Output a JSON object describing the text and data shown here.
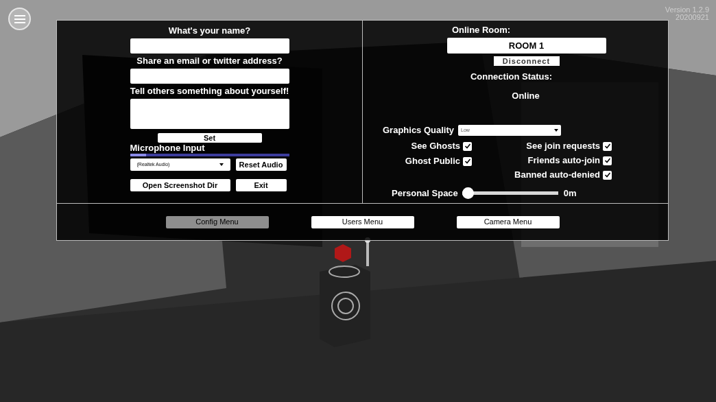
{
  "version": {
    "label": "Version 1.2.9",
    "build": "20200921"
  },
  "profile": {
    "fields": [
      {
        "label": "What's your name?",
        "kind": "line"
      },
      {
        "label": "Share an email or twitter address?",
        "kind": "line"
      },
      {
        "label": "Tell others something about yourself!",
        "kind": "area"
      }
    ],
    "set_button": "Set",
    "microphone": {
      "label": "Microphone Input",
      "level": 0.1,
      "device": "(Realtek Audio)",
      "reset_button": "Reset Audio"
    },
    "buttons": [
      "Open Screenshot Dir",
      "Exit"
    ]
  },
  "room": {
    "label": "Online Room:",
    "value": "ROOM 1",
    "disconnect_button": "Disconnect",
    "status_label": "Connection Status:",
    "status": "Online",
    "graphics": {
      "label": "Graphics Quality",
      "value": "Low"
    },
    "ghost_options": [
      {
        "label": "See Ghosts",
        "checked": true
      },
      {
        "label": "Ghost Public",
        "checked": true
      }
    ],
    "join_options": [
      {
        "label": "See join requests",
        "checked": true
      },
      {
        "label": "Friends auto-join",
        "checked": true
      },
      {
        "label": "Banned auto-denied",
        "checked": true
      }
    ],
    "personal_space": {
      "label": "Personal Space",
      "level": 0,
      "reading": "0m"
    }
  },
  "tabs": [
    {
      "label": "Config Menu",
      "selected": true
    },
    {
      "label": "Users Menu",
      "selected": false
    },
    {
      "label": "Camera Menu",
      "selected": false
    }
  ]
}
